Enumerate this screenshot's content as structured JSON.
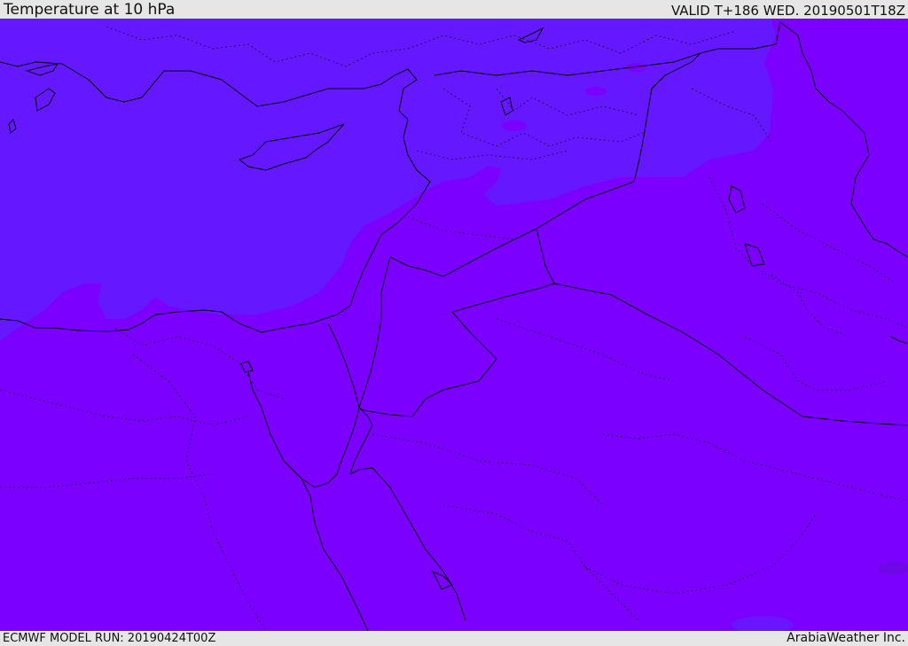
{
  "header": {
    "title": "Temperature at 10 hPa",
    "valid_time": "VALID T+186 WED. 20190501T18Z"
  },
  "footer": {
    "model_run": "ECMWF MODEL RUN: 20190424T00Z",
    "credit": "ArabiaWeather Inc."
  },
  "map": {
    "colors": {
      "warm_field": "#7b00ff",
      "cool_field": "#6517ff",
      "border": "#000000"
    }
  }
}
